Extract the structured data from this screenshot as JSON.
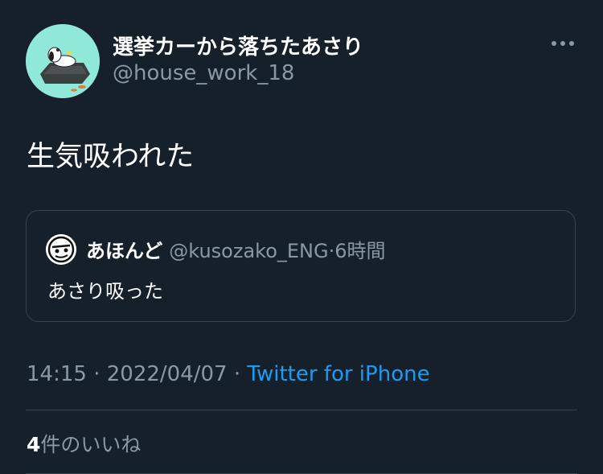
{
  "author": {
    "display_name": "選挙カーから落ちたあさり",
    "handle": "@house_work_18",
    "avatar_icon": "snoopy-on-roof-avatar"
  },
  "more_icon": "more-horizontal-icon",
  "tweet": {
    "text": "生気吸われた"
  },
  "quoted_tweet": {
    "display_name": "あほんど",
    "handle": "@kusozako_ENG",
    "separator": "·",
    "time": "6時間",
    "text": "あさり吸った",
    "avatar_icon": "doodle-face-avatar"
  },
  "meta": {
    "time": "14:15",
    "separator1": " · ",
    "date": "2022/04/07",
    "separator2": " · ",
    "source": "Twitter for iPhone"
  },
  "likes": {
    "count": "4",
    "label": "件のいいね"
  },
  "colors": {
    "background": "#15202b",
    "text": "#ffffff",
    "secondary": "#8b98a5",
    "accent": "#1d9bf0",
    "border": "#38444d"
  }
}
